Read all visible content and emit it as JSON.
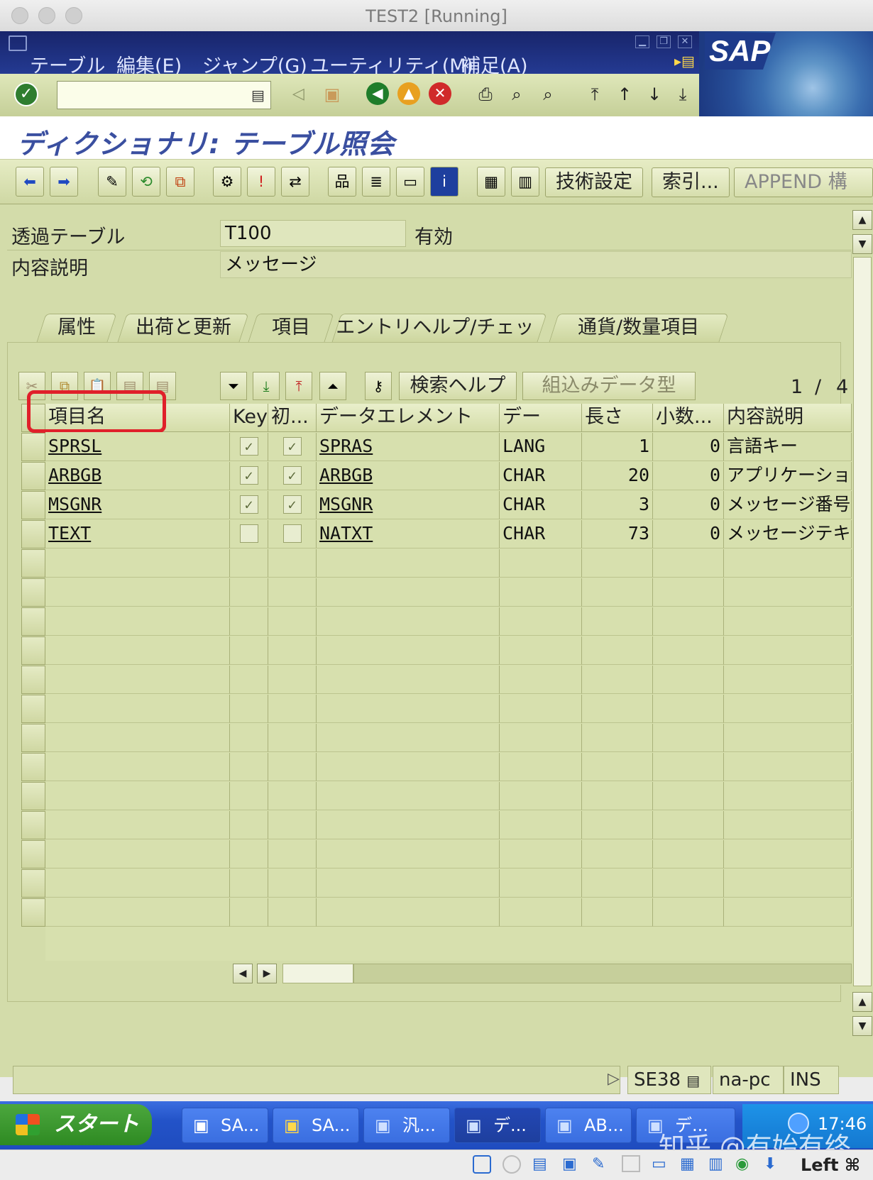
{
  "window": {
    "title": "TEST2 [Running]"
  },
  "menu": {
    "items": [
      "テーブル",
      "編集(E)",
      "ジャンプ(G)",
      "ユーティリティ(M)",
      "補足(A)"
    ],
    "logo": "SAP"
  },
  "system_toolbar": {
    "command_value": ""
  },
  "page_title": "ディクショナリ: テーブル照会",
  "app_toolbar": {
    "tech_settings": "技術設定",
    "index": "索引...",
    "append": "APPEND 構"
  },
  "header_fields": {
    "transparent_table_label": "透過テーブル",
    "table_name": "T100",
    "status": "有効",
    "description_label": "内容説明",
    "description": "メッセージ"
  },
  "tabs": [
    {
      "label": "属性",
      "active": false
    },
    {
      "label": "出荷と更新",
      "active": false
    },
    {
      "label": "項目",
      "active": true
    },
    {
      "label": "エントリヘルプ/チェック",
      "active": false
    },
    {
      "label": "通貨/数量項目",
      "active": false
    }
  ],
  "grid_toolbar": {
    "search_help": "検索ヘルプ",
    "builtin_type": "組込みデータ型",
    "page_current": "1",
    "page_sep": "/",
    "page_total": "4"
  },
  "columns": [
    "項目名",
    "Key",
    "初...",
    "データエレメント",
    "デー",
    "長さ",
    "小数...",
    "内容説明"
  ],
  "rows": [
    {
      "field": "SPRSL",
      "key": true,
      "init": true,
      "element": "SPRAS",
      "type": "LANG",
      "length": "1",
      "decimals": "0",
      "desc": "言語キー"
    },
    {
      "field": "ARBGB",
      "key": true,
      "init": true,
      "element": "ARBGB",
      "type": "CHAR",
      "length": "20",
      "decimals": "0",
      "desc": "アプリケーションエ"
    },
    {
      "field": "MSGNR",
      "key": true,
      "init": true,
      "element": "MSGNR",
      "type": "CHAR",
      "length": "3",
      "decimals": "0",
      "desc": "メッセージ番号"
    },
    {
      "field": "TEXT",
      "key": false,
      "init": false,
      "element": "NATXT",
      "type": "CHAR",
      "length": "73",
      "decimals": "0",
      "desc": "メッセージテキスト"
    }
  ],
  "status_bar": {
    "transaction": "SE38",
    "host": "na-pc",
    "mode": "INS"
  },
  "taskbar": {
    "start": "スタート",
    "items": [
      "SA...",
      "SA...",
      "汎...",
      "デ...",
      "AB...",
      "デ..."
    ],
    "clock": "17:46"
  },
  "watermark": "知乎 @有始有终",
  "mac_bottom": {
    "label": "Left ⌘"
  },
  "colors": {
    "sap_green": "#d3dcaa",
    "menu_blue": "#1d2d7c",
    "highlight_red": "#e0202a",
    "taskbar_blue": "#2353c8"
  }
}
